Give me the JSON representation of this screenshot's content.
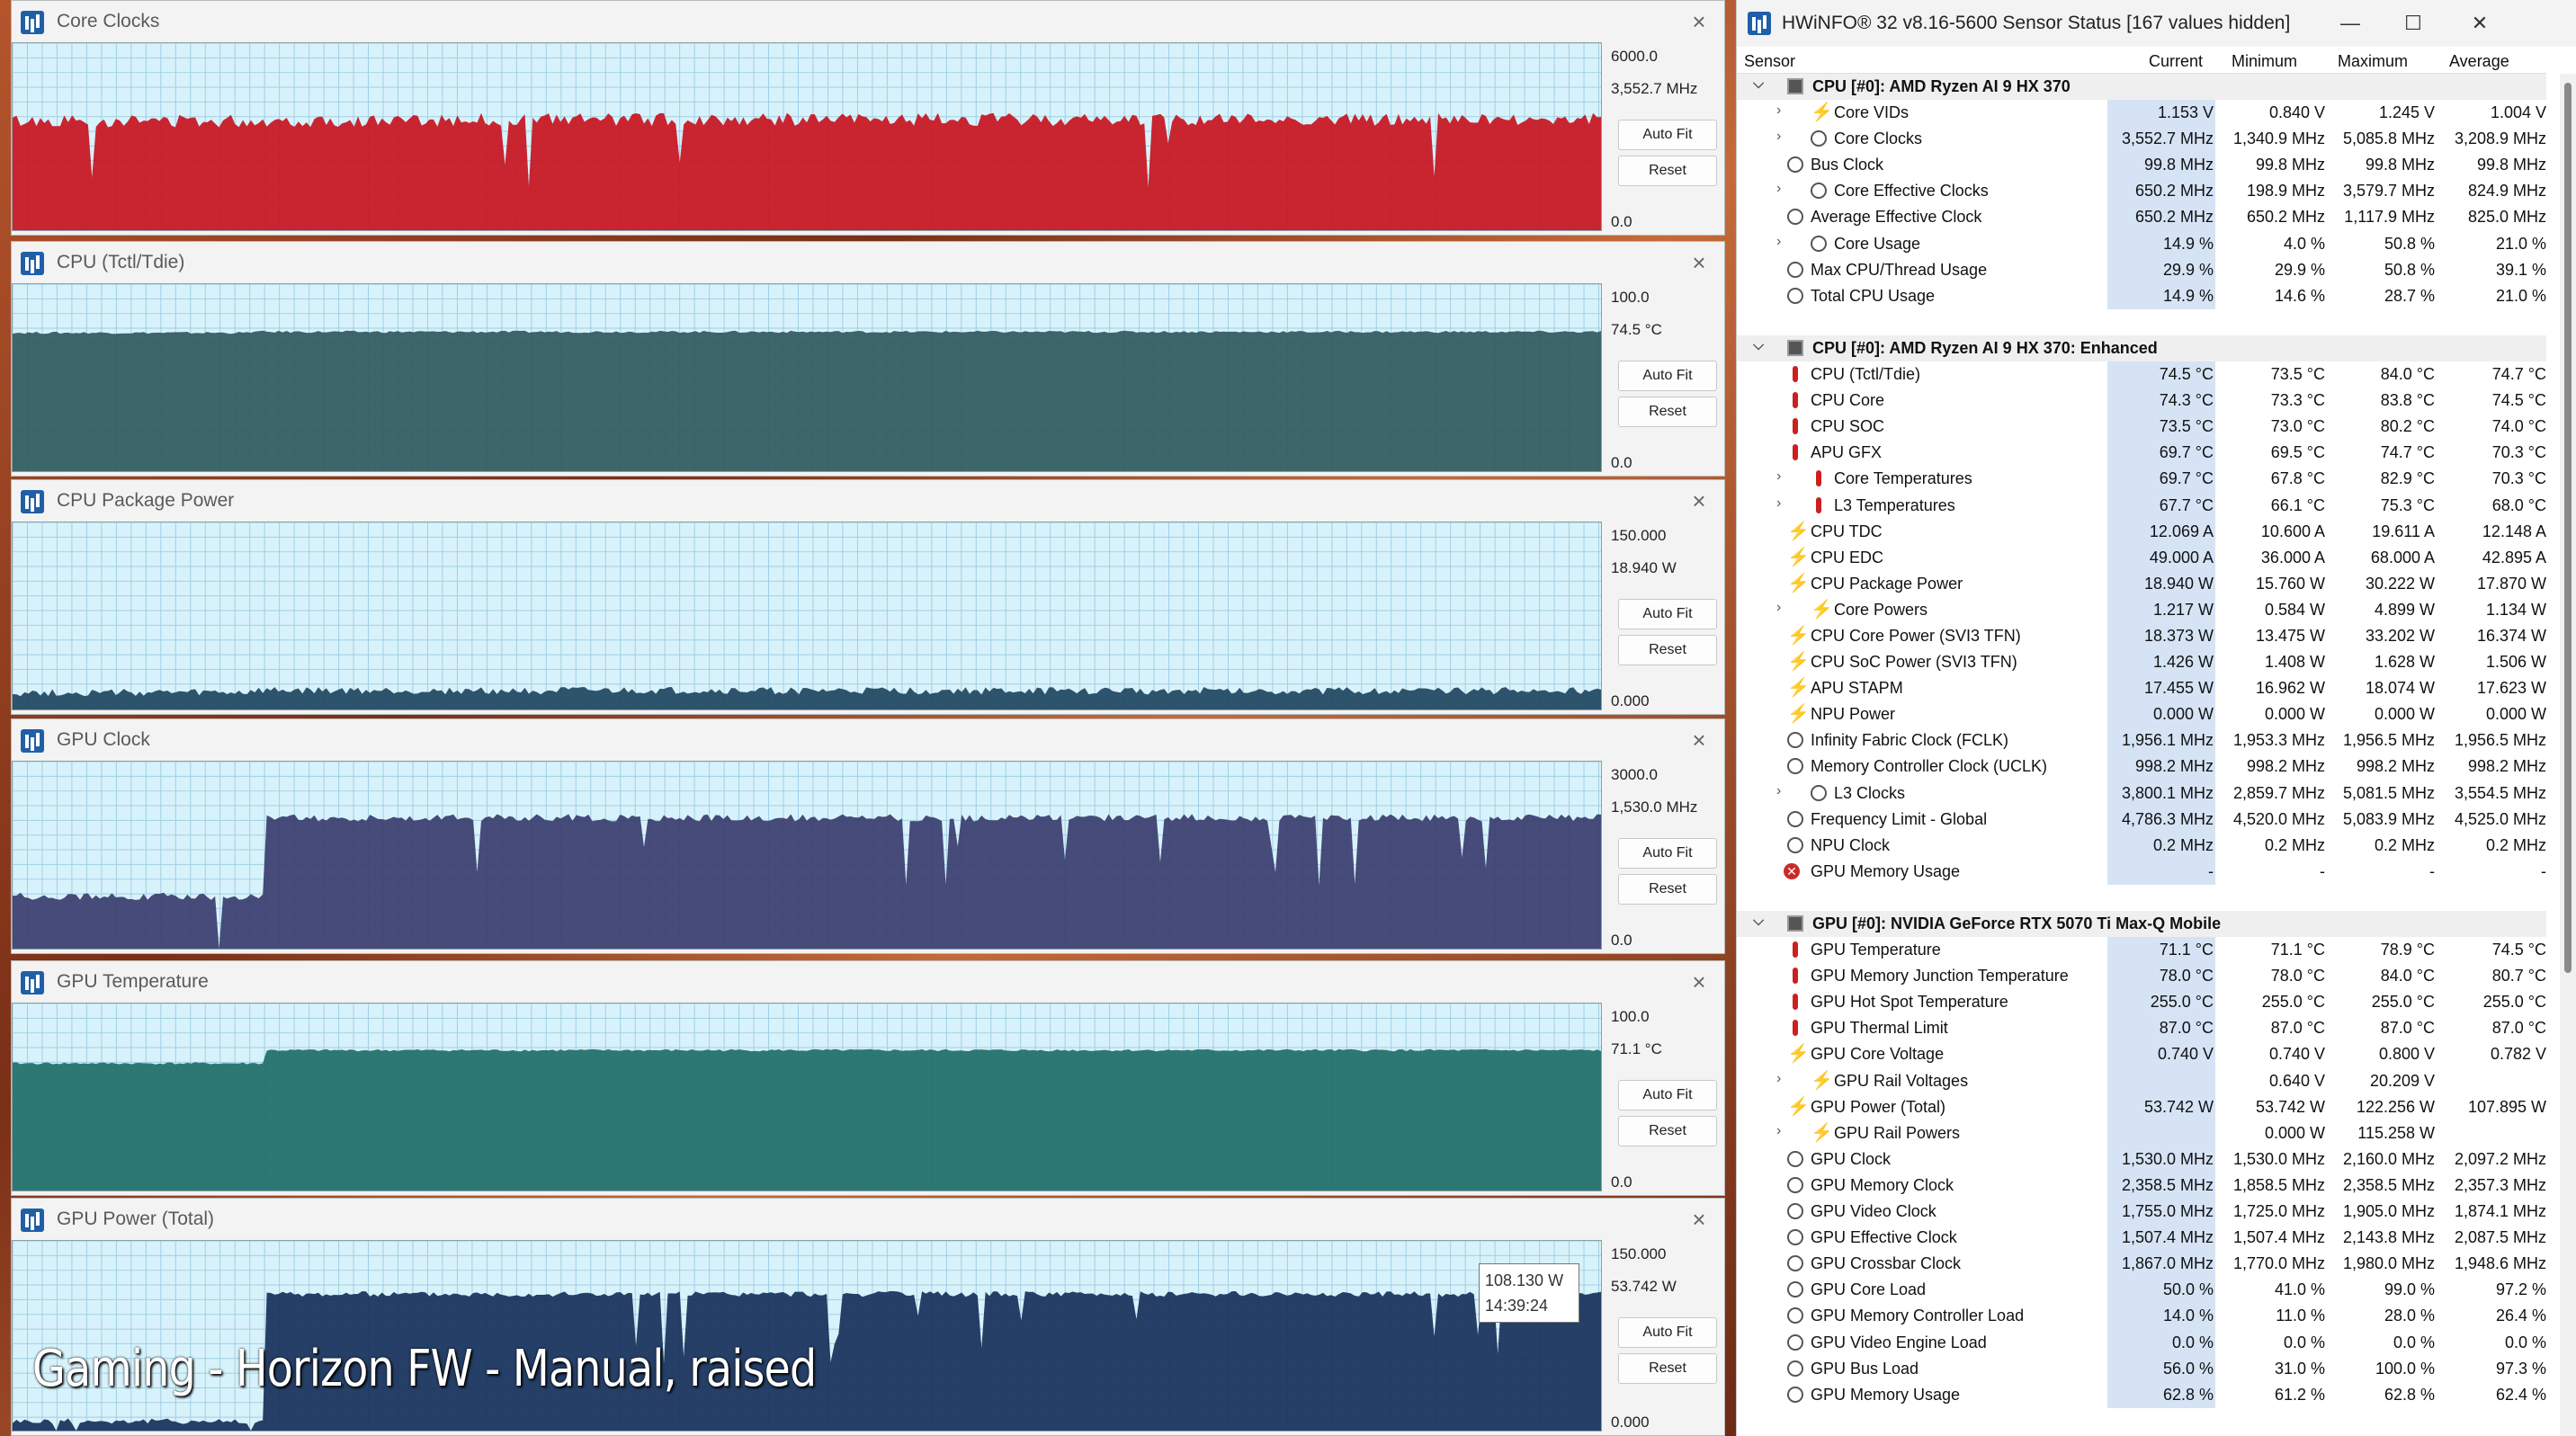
{
  "graphs": [
    {
      "title": "Core Clocks",
      "max": "6000.0",
      "current": "3,552.7 MHz",
      "min": "0.0",
      "auto_fit": "Auto Fit",
      "reset": "Reset",
      "fill": "#c8141e",
      "level": 0.592,
      "early_level": 0.585,
      "step_at": 0.27,
      "noise": 0.035,
      "spike_down": true
    },
    {
      "title": "CPU (Tctl/Tdie)",
      "max": "100.0",
      "current": "74.5 °C",
      "min": "0.0",
      "auto_fit": "Auto Fit",
      "reset": "Reset",
      "fill": "#2f5a5c",
      "level": 0.745,
      "early_level": 0.74,
      "step_at": 0.15,
      "noise": 0.006,
      "spike_down": false
    },
    {
      "title": "CPU Package Power",
      "max": "150.000",
      "current": "18.940 W",
      "min": "0.000",
      "auto_fit": "Auto Fit",
      "reset": "Reset",
      "fill": "#1e4660",
      "level": 0.1,
      "early_level": 0.09,
      "step_at": 0.15,
      "noise": 0.02,
      "spike_down": false
    },
    {
      "title": "GPU Clock",
      "max": "3000.0",
      "current": "1,530.0 MHz",
      "min": "0.0",
      "auto_fit": "Auto Fit",
      "reset": "Reset",
      "fill": "#3a3d6e",
      "level": 0.7,
      "early_level": 0.28,
      "step_at": 0.16,
      "noise": 0.02,
      "spike_down": true
    },
    {
      "title": "GPU Temperature",
      "max": "100.0",
      "current": "71.1 °C",
      "min": "0.0",
      "auto_fit": "Auto Fit",
      "reset": "Reset",
      "fill": "#1f6e68",
      "level": 0.75,
      "early_level": 0.68,
      "step_at": 0.16,
      "noise": 0.006,
      "spike_down": false
    },
    {
      "title": "GPU Power (Total)",
      "max": "150.000",
      "current": "53.742 W",
      "min": "0.000",
      "auto_fit": "Auto Fit",
      "reset": "Reset",
      "fill": "#17305a",
      "level": 0.72,
      "early_level": 0.05,
      "step_at": 0.16,
      "noise": 0.015,
      "spike_down": true
    }
  ],
  "tooltip": {
    "value": "108.130 W",
    "time": "14:39:24"
  },
  "caption": "Gaming - Horizon FW - Manual, raised",
  "sensor_window": {
    "title": "HWiNFO® 32 v8.16-5600 Sensor Status [167 values hidden]",
    "columns": {
      "sensor": "Sensor",
      "current": "Current",
      "minimum": "Minimum",
      "maximum": "Maximum",
      "average": "Average"
    },
    "rows": [
      {
        "type": "group",
        "name": "CPU [#0]: AMD Ryzen AI 9 HX 370"
      },
      {
        "icon": "bolt",
        "exp": true,
        "name": "Core VIDs",
        "cur": "1.153 V",
        "min": "0.840 V",
        "max": "1.245 V",
        "avg": "1.004 V"
      },
      {
        "icon": "clock",
        "exp": true,
        "name": "Core Clocks",
        "cur": "3,552.7 MHz",
        "min": "1,340.9 MHz",
        "max": "5,085.8 MHz",
        "avg": "3,208.9 MHz"
      },
      {
        "icon": "clock",
        "name": "Bus Clock",
        "cur": "99.8 MHz",
        "min": "99.8 MHz",
        "max": "99.8 MHz",
        "avg": "99.8 MHz"
      },
      {
        "icon": "clock",
        "exp": true,
        "name": "Core Effective Clocks",
        "cur": "650.2 MHz",
        "min": "198.9 MHz",
        "max": "3,579.7 MHz",
        "avg": "824.9 MHz"
      },
      {
        "icon": "clock",
        "name": "Average Effective Clock",
        "cur": "650.2 MHz",
        "min": "650.2 MHz",
        "max": "1,117.9 MHz",
        "avg": "825.0 MHz"
      },
      {
        "icon": "clock",
        "exp": true,
        "name": "Core Usage",
        "cur": "14.9 %",
        "min": "4.0 %",
        "max": "50.8 %",
        "avg": "21.0 %"
      },
      {
        "icon": "clock",
        "name": "Max CPU/Thread Usage",
        "cur": "29.9 %",
        "min": "29.9 %",
        "max": "50.8 %",
        "avg": "39.1 %"
      },
      {
        "icon": "clock",
        "name": "Total CPU Usage",
        "cur": "14.9 %",
        "min": "14.6 %",
        "max": "28.7 %",
        "avg": "21.0 %"
      },
      {
        "type": "blank"
      },
      {
        "type": "group",
        "name": "CPU [#0]: AMD Ryzen AI 9 HX 370: Enhanced"
      },
      {
        "icon": "temp",
        "name": "CPU (Tctl/Tdie)",
        "cur": "74.5 °C",
        "min": "73.5 °C",
        "max": "84.0 °C",
        "avg": "74.7 °C"
      },
      {
        "icon": "temp",
        "name": "CPU Core",
        "cur": "74.3 °C",
        "min": "73.3 °C",
        "max": "83.8 °C",
        "avg": "74.5 °C"
      },
      {
        "icon": "temp",
        "name": "CPU SOC",
        "cur": "73.5 °C",
        "min": "73.0 °C",
        "max": "80.2 °C",
        "avg": "74.0 °C"
      },
      {
        "icon": "temp",
        "name": "APU GFX",
        "cur": "69.7 °C",
        "min": "69.5 °C",
        "max": "74.7 °C",
        "avg": "70.3 °C"
      },
      {
        "icon": "temp",
        "exp": true,
        "name": "Core Temperatures",
        "cur": "69.7 °C",
        "min": "67.8 °C",
        "max": "82.9 °C",
        "avg": "70.3 °C"
      },
      {
        "icon": "temp",
        "exp": true,
        "name": "L3 Temperatures",
        "cur": "67.7 °C",
        "min": "66.1 °C",
        "max": "75.3 °C",
        "avg": "68.0 °C"
      },
      {
        "icon": "bolt",
        "name": "CPU TDC",
        "cur": "12.069 A",
        "min": "10.600 A",
        "max": "19.611 A",
        "avg": "12.148 A"
      },
      {
        "icon": "bolt",
        "name": "CPU EDC",
        "cur": "49.000 A",
        "min": "36.000 A",
        "max": "68.000 A",
        "avg": "42.895 A"
      },
      {
        "icon": "bolt",
        "name": "CPU Package Power",
        "cur": "18.940 W",
        "min": "15.760 W",
        "max": "30.222 W",
        "avg": "17.870 W"
      },
      {
        "icon": "bolt",
        "exp": true,
        "name": "Core Powers",
        "cur": "1.217 W",
        "min": "0.584 W",
        "max": "4.899 W",
        "avg": "1.134 W"
      },
      {
        "icon": "bolt",
        "name": "CPU Core Power (SVI3 TFN)",
        "cur": "18.373 W",
        "min": "13.475 W",
        "max": "33.202 W",
        "avg": "16.374 W"
      },
      {
        "icon": "bolt",
        "name": "CPU SoC Power (SVI3 TFN)",
        "cur": "1.426 W",
        "min": "1.408 W",
        "max": "1.628 W",
        "avg": "1.506 W"
      },
      {
        "icon": "bolt",
        "name": "APU STAPM",
        "cur": "17.455 W",
        "min": "16.962 W",
        "max": "18.074 W",
        "avg": "17.623 W"
      },
      {
        "icon": "bolt",
        "name": "NPU Power",
        "cur": "0.000 W",
        "min": "0.000 W",
        "max": "0.000 W",
        "avg": "0.000 W"
      },
      {
        "icon": "clock",
        "name": "Infinity Fabric Clock (FCLK)",
        "cur": "1,956.1 MHz",
        "min": "1,953.3 MHz",
        "max": "1,956.5 MHz",
        "avg": "1,956.5 MHz"
      },
      {
        "icon": "clock",
        "name": "Memory Controller Clock (UCLK)",
        "cur": "998.2 MHz",
        "min": "998.2 MHz",
        "max": "998.2 MHz",
        "avg": "998.2 MHz"
      },
      {
        "icon": "clock",
        "exp": true,
        "name": "L3 Clocks",
        "cur": "3,800.1 MHz",
        "min": "2,859.7 MHz",
        "max": "5,081.5 MHz",
        "avg": "3,554.5 MHz"
      },
      {
        "icon": "clock",
        "name": "Frequency Limit - Global",
        "cur": "4,786.3 MHz",
        "min": "4,520.0 MHz",
        "max": "5,083.9 MHz",
        "avg": "4,525.0 MHz"
      },
      {
        "icon": "clock",
        "name": "NPU Clock",
        "cur": "0.2 MHz",
        "min": "0.2 MHz",
        "max": "0.2 MHz",
        "avg": "0.2 MHz"
      },
      {
        "icon": "error",
        "name": "GPU Memory Usage",
        "cur": "-",
        "min": "-",
        "max": "-",
        "avg": "-"
      },
      {
        "type": "blank"
      },
      {
        "type": "group",
        "name": "GPU [#0]: NVIDIA  GeForce RTX 5070 Ti Max-Q Mobile"
      },
      {
        "icon": "temp",
        "name": "GPU Temperature",
        "cur": "71.1 °C",
        "min": "71.1 °C",
        "max": "78.9 °C",
        "avg": "74.5 °C"
      },
      {
        "icon": "temp",
        "name": "GPU Memory Junction Temperature",
        "cur": "78.0 °C",
        "min": "78.0 °C",
        "max": "84.0 °C",
        "avg": "80.7 °C"
      },
      {
        "icon": "temp",
        "name": "GPU Hot Spot Temperature",
        "cur": "255.0 °C",
        "min": "255.0 °C",
        "max": "255.0 °C",
        "avg": "255.0 °C"
      },
      {
        "icon": "temp",
        "name": "GPU Thermal Limit",
        "cur": "87.0 °C",
        "min": "87.0 °C",
        "max": "87.0 °C",
        "avg": "87.0 °C"
      },
      {
        "icon": "bolt",
        "name": "GPU Core Voltage",
        "cur": "0.740 V",
        "min": "0.740 V",
        "max": "0.800 V",
        "avg": "0.782 V"
      },
      {
        "icon": "bolt",
        "exp": true,
        "name": "GPU Rail Voltages",
        "cur": "",
        "min": "0.640 V",
        "max": "20.209 V",
        "avg": ""
      },
      {
        "icon": "bolt",
        "name": "GPU Power (Total)",
        "cur": "53.742 W",
        "min": "53.742 W",
        "max": "122.256 W",
        "avg": "107.895 W"
      },
      {
        "icon": "bolt",
        "exp": true,
        "name": "GPU Rail Powers",
        "cur": "",
        "min": "0.000 W",
        "max": "115.258 W",
        "avg": ""
      },
      {
        "icon": "clock",
        "name": "GPU Clock",
        "cur": "1,530.0 MHz",
        "min": "1,530.0 MHz",
        "max": "2,160.0 MHz",
        "avg": "2,097.2 MHz"
      },
      {
        "icon": "clock",
        "name": "GPU Memory Clock",
        "cur": "2,358.5 MHz",
        "min": "1,858.5 MHz",
        "max": "2,358.5 MHz",
        "avg": "2,357.3 MHz"
      },
      {
        "icon": "clock",
        "name": "GPU Video Clock",
        "cur": "1,755.0 MHz",
        "min": "1,725.0 MHz",
        "max": "1,905.0 MHz",
        "avg": "1,874.1 MHz"
      },
      {
        "icon": "clock",
        "name": "GPU Effective Clock",
        "cur": "1,507.4 MHz",
        "min": "1,507.4 MHz",
        "max": "2,143.8 MHz",
        "avg": "2,087.5 MHz"
      },
      {
        "icon": "clock",
        "name": "GPU Crossbar Clock",
        "cur": "1,867.0 MHz",
        "min": "1,770.0 MHz",
        "max": "1,980.0 MHz",
        "avg": "1,948.6 MHz"
      },
      {
        "icon": "clock",
        "name": "GPU Core Load",
        "cur": "50.0 %",
        "min": "41.0 %",
        "max": "99.0 %",
        "avg": "97.2 %"
      },
      {
        "icon": "clock",
        "name": "GPU Memory Controller Load",
        "cur": "14.0 %",
        "min": "11.0 %",
        "max": "28.0 %",
        "avg": "26.4 %"
      },
      {
        "icon": "clock",
        "name": "GPU Video Engine Load",
        "cur": "0.0 %",
        "min": "0.0 %",
        "max": "0.0 %",
        "avg": "0.0 %"
      },
      {
        "icon": "clock",
        "name": "GPU Bus Load",
        "cur": "56.0 %",
        "min": "31.0 %",
        "max": "100.0 %",
        "avg": "97.3 %"
      },
      {
        "icon": "clock",
        "name": "GPU Memory Usage",
        "cur": "62.8 %",
        "min": "61.2 %",
        "max": "62.8 %",
        "avg": "62.4 %"
      }
    ]
  }
}
